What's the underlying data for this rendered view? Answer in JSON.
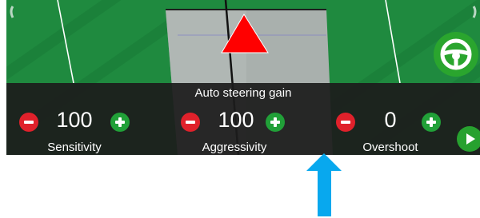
{
  "panel": {
    "title": "Auto steering gain",
    "controls": [
      {
        "label": "Sensitivity",
        "value": "100"
      },
      {
        "label": "Aggressivity",
        "value": "100"
      },
      {
        "label": "Overshoot",
        "value": "0"
      }
    ]
  },
  "icons": {
    "steering_wheel": "steering-wheel-icon",
    "play": "play-icon",
    "vehicle_marker": "triangle-marker-icon",
    "annotation_arrow": "up-arrow"
  },
  "colors": {
    "field_green": "#1f8a3f",
    "minus_red": "#e0212b",
    "plus_green": "#21a038",
    "arrow_blue": "#08a8ee",
    "marker_red": "#ff0000"
  }
}
